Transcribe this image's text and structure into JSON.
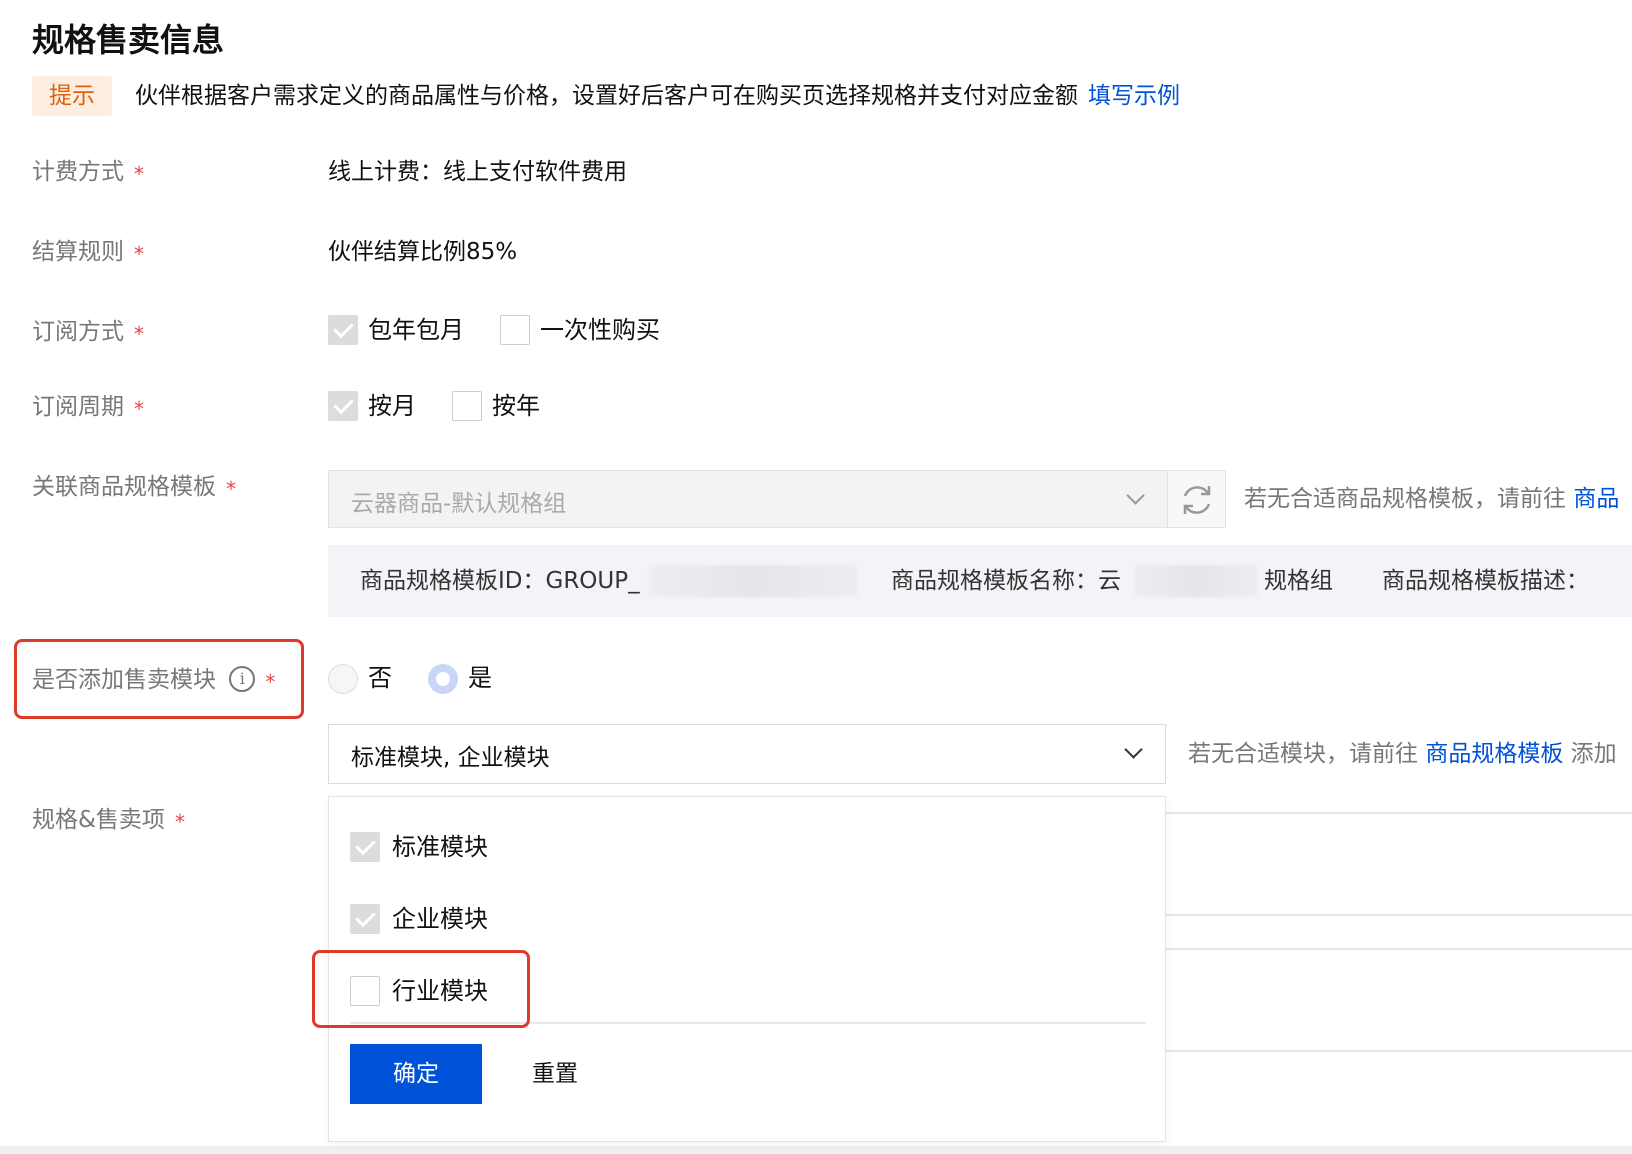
{
  "section_title": "规格售卖信息",
  "tip": {
    "badge": "提示",
    "text": "伙伴根据客户需求定义的商品属性与价格，设置好后客户可在购买页选择规格并支付对应金额",
    "link": "填写示例"
  },
  "required_mark": "*",
  "billing": {
    "label": "计费方式",
    "value": "线上计费：线上支付软件费用"
  },
  "settlement": {
    "label": "结算规则",
    "value": "伙伴结算比例85%"
  },
  "subscription_mode": {
    "label": "订阅方式",
    "options": [
      {
        "label": "包年包月",
        "checked": true
      },
      {
        "label": "一次性购买",
        "checked": false
      }
    ]
  },
  "subscription_period": {
    "label": "订阅周期",
    "options": [
      {
        "label": "按月",
        "checked": true
      },
      {
        "label": "按年",
        "checked": false
      }
    ]
  },
  "template": {
    "label": "关联商品规格模板",
    "selected": "云器商品-默认规格组",
    "hint_prefix": "若无合适商品规格模板，请前往",
    "hint_link": "商品"
  },
  "template_info": {
    "id_label": "商品规格模板ID：GROUP_",
    "name_label": "商品规格模板名称：云",
    "name_suffix": "规格组",
    "desc_label": "商品规格模板描述："
  },
  "add_module": {
    "label": "是否添加售卖模块",
    "info_icon": "i",
    "options": [
      {
        "label": "否",
        "selected": false
      },
      {
        "label": "是",
        "selected": true
      }
    ]
  },
  "module_select": {
    "value": "标准模块, 企业模块",
    "hint_prefix": "若无合适模块，请前往",
    "hint_link": "商品规格模板",
    "hint_suffix": "添加"
  },
  "spec_items": {
    "label": "规格&售卖项"
  },
  "dropdown": {
    "options": [
      {
        "label": "标准模块",
        "checked": true
      },
      {
        "label": "企业模块",
        "checked": true
      },
      {
        "label": "行业模块",
        "checked": false
      }
    ],
    "confirm": "确定",
    "reset": "重置"
  },
  "colors": {
    "primary": "#0052d9",
    "highlight_box": "#e03a2a",
    "required": "#e54545",
    "tip_badge_bg": "#fdeee2",
    "tip_badge_text": "#e2600c"
  }
}
